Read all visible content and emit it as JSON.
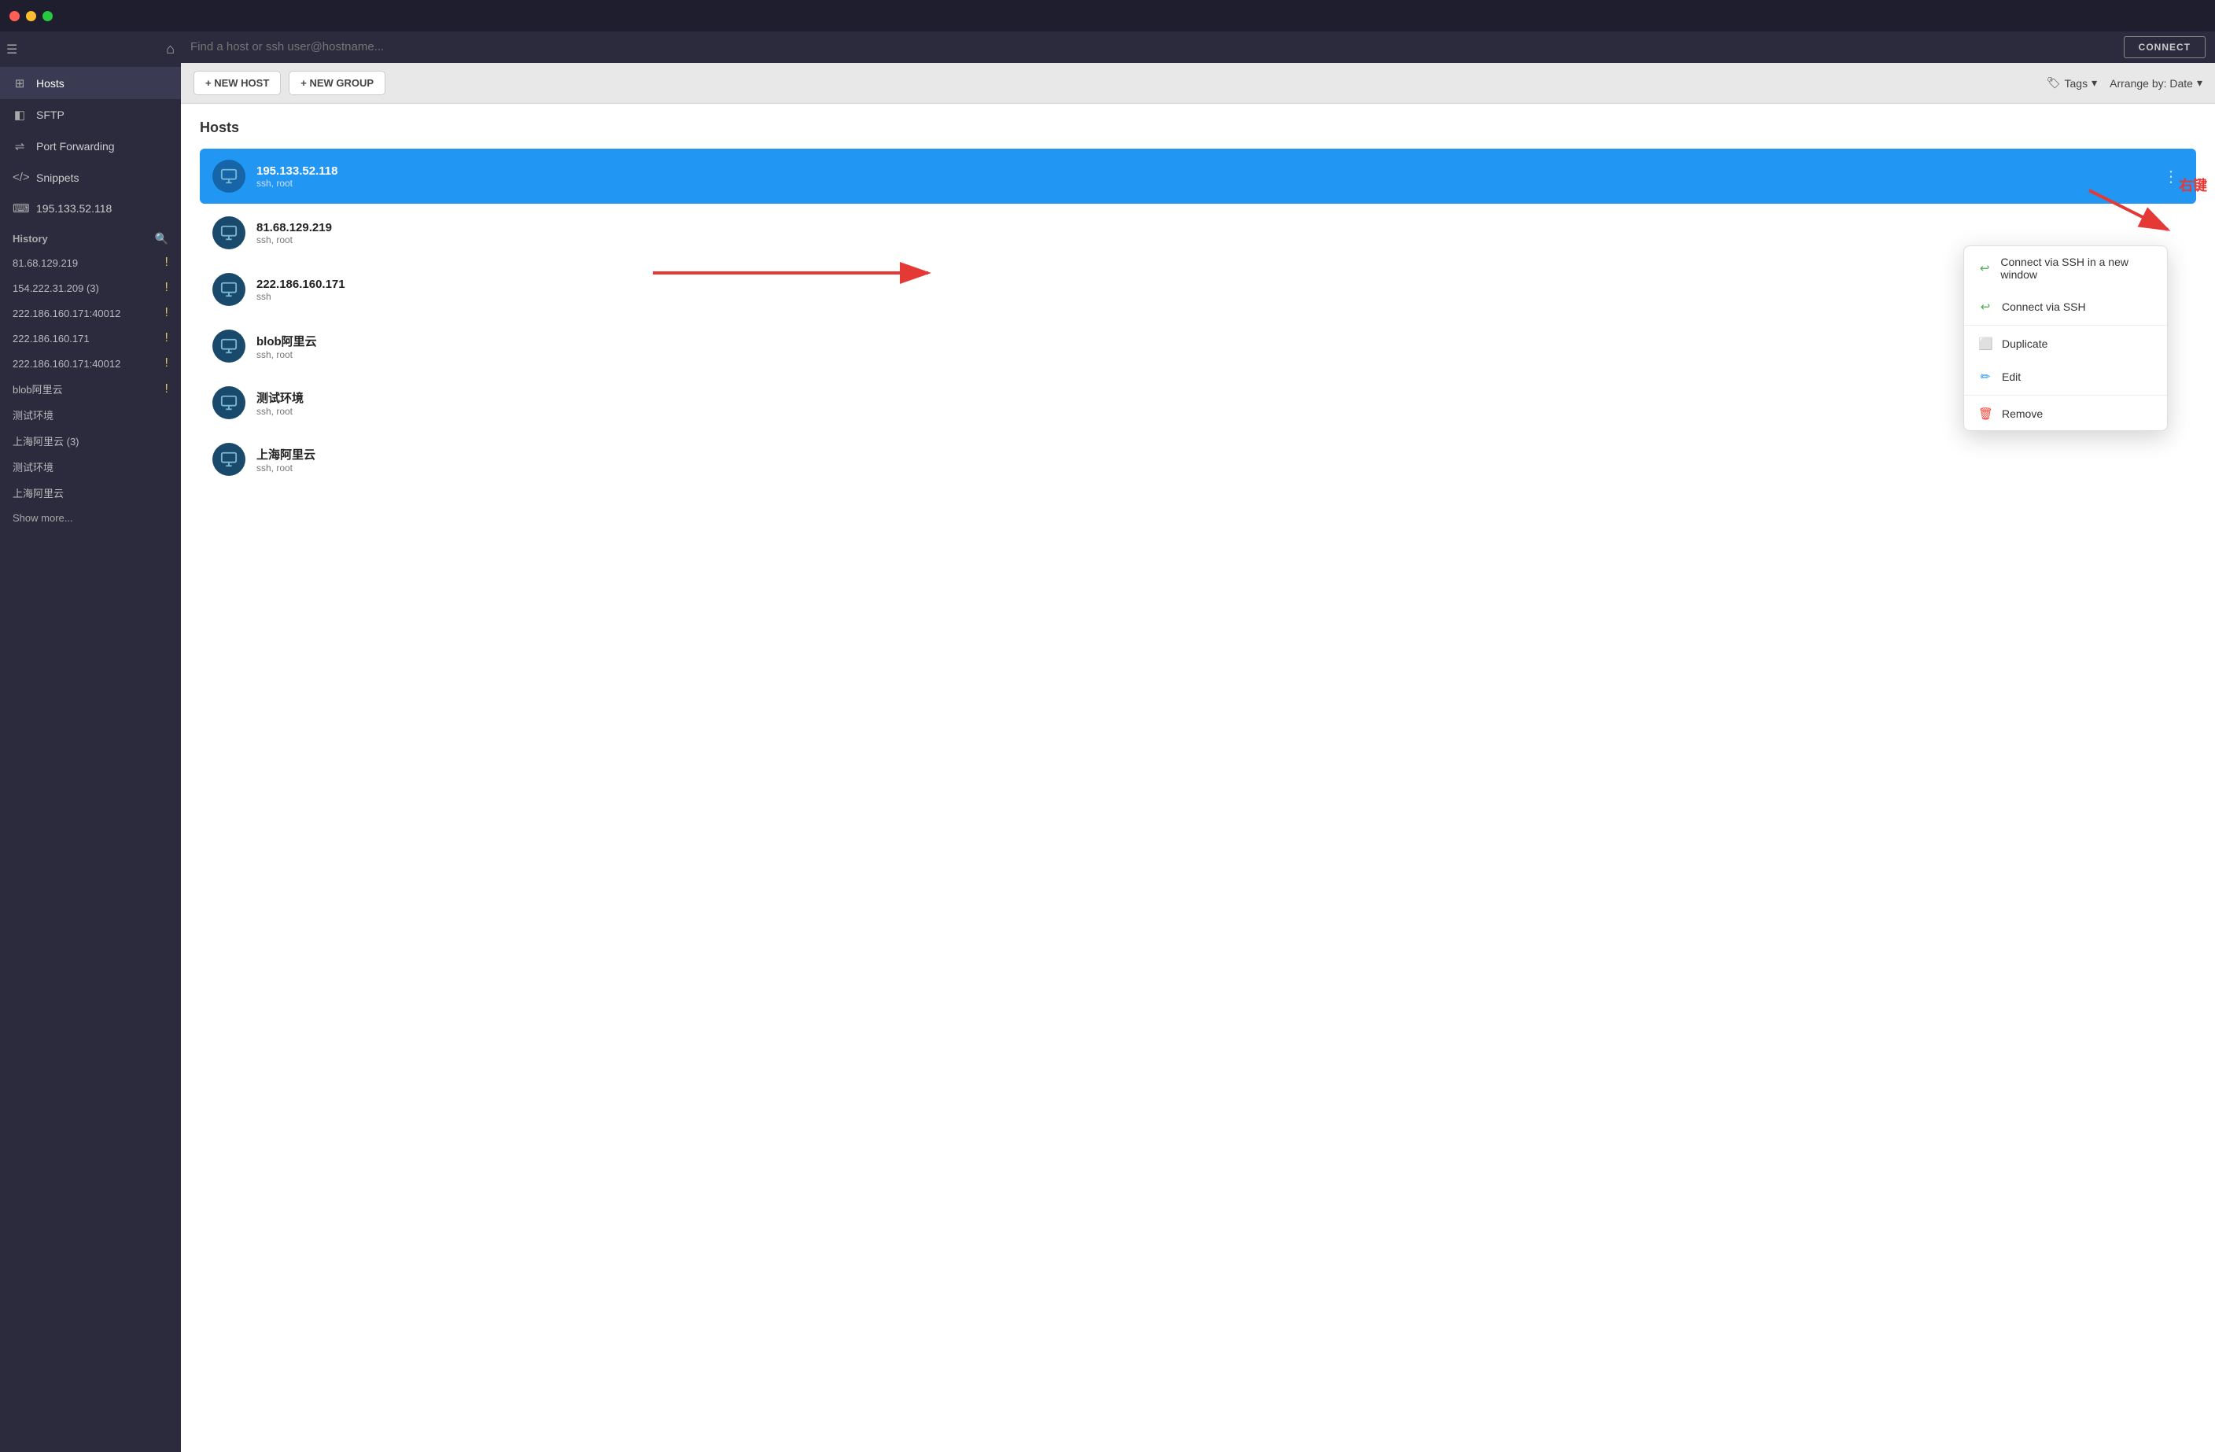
{
  "titlebar": {
    "lights": [
      "close",
      "minimize",
      "maximize"
    ]
  },
  "topbar": {
    "search_placeholder": "Find a host or ssh user@hostname...",
    "connect_label": "CONNECT"
  },
  "sidebar": {
    "nav_items": [
      {
        "id": "hosts",
        "label": "Hosts",
        "icon": "⊞",
        "active": true
      },
      {
        "id": "sftp",
        "label": "SFTP",
        "icon": "◧"
      },
      {
        "id": "port-forwarding",
        "label": "Port Forwarding",
        "icon": "⇌"
      },
      {
        "id": "snippets",
        "label": "Snippets",
        "icon": "</>"
      }
    ],
    "current_host": "195.133.52.118",
    "history_section_label": "History",
    "history_items": [
      {
        "label": "81.68.129.219",
        "warn": true
      },
      {
        "label": "154.222.31.209 (3)",
        "warn": true
      },
      {
        "label": "222.186.160.171:40012",
        "warn": true
      },
      {
        "label": "222.186.160.171",
        "warn": true
      },
      {
        "label": "222.186.160.171:40012",
        "warn": true
      },
      {
        "label": "blob阿里云",
        "warn": true
      },
      {
        "label": "测试环境",
        "warn": false
      },
      {
        "label": "上海阿里云 (3)",
        "warn": false
      },
      {
        "label": "测试环境",
        "warn": false
      },
      {
        "label": "上海阿里云",
        "warn": false
      }
    ],
    "show_more_label": "Show more..."
  },
  "toolbar": {
    "new_host_label": "+ NEW HOST",
    "new_group_label": "+ NEW GROUP",
    "tags_label": "Tags",
    "arrange_label": "Arrange by: Date"
  },
  "content": {
    "section_title": "Hosts",
    "hosts": [
      {
        "name": "195.133.52.118",
        "sub": "ssh, root",
        "active": true
      },
      {
        "name": "81.68.129.219",
        "sub": "ssh, root",
        "active": false
      },
      {
        "name": "222.186.160.171",
        "sub": "ssh",
        "active": false
      },
      {
        "name": "blob阿里云",
        "sub": "ssh, root",
        "active": false
      },
      {
        "name": "测试环境",
        "sub": "ssh, root",
        "active": false
      },
      {
        "name": "上海阿里云",
        "sub": "ssh, root",
        "active": false
      }
    ]
  },
  "context_menu": {
    "items": [
      {
        "id": "connect-new-window",
        "label": "Connect via SSH in a new window",
        "icon_type": "arrow-green"
      },
      {
        "id": "connect-ssh",
        "label": "Connect via SSH",
        "icon_type": "arrow-green"
      },
      {
        "id": "duplicate",
        "label": "Duplicate",
        "icon_type": "square-blue"
      },
      {
        "id": "edit",
        "label": "Edit",
        "icon_type": "pencil-blue"
      },
      {
        "id": "remove",
        "label": "Remove",
        "icon_type": "trash-red"
      }
    ]
  },
  "annotation": {
    "right_click_label": "右键"
  }
}
